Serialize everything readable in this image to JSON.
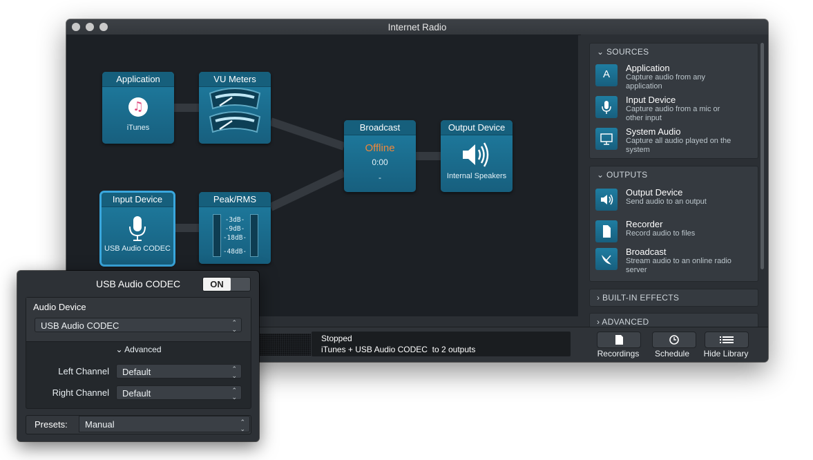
{
  "window": {
    "title": "Internet Radio"
  },
  "nodes": {
    "application": {
      "header": "Application",
      "label": "iTunes"
    },
    "vu_meters": {
      "header": "VU Meters"
    },
    "broadcast": {
      "header": "Broadcast",
      "status": "Offline",
      "time": "0:00",
      "detail": "-"
    },
    "output_device": {
      "header": "Output Device",
      "label": "Internal Speakers"
    },
    "input_device": {
      "header": "Input Device",
      "label": "USB Audio CODEC"
    },
    "peak_rms": {
      "header": "Peak/RMS",
      "scale": [
        "-3dB-",
        "-9dB-",
        "-18dB-",
        "-48dB-"
      ]
    }
  },
  "sidebar": {
    "sources": {
      "title": "SOURCES",
      "items": [
        {
          "title": "Application",
          "desc": "Capture audio from any application",
          "icon": "app-store-icon"
        },
        {
          "title": "Input Device",
          "desc": "Capture audio from a mic or other input",
          "icon": "microphone-icon"
        },
        {
          "title": "System Audio",
          "desc": "Capture all audio played on the system",
          "icon": "monitor-icon"
        }
      ]
    },
    "outputs": {
      "title": "OUTPUTS",
      "items": [
        {
          "title": "Output Device",
          "desc": "Send audio to an output",
          "icon": "speaker-icon"
        },
        {
          "title": "Recorder",
          "desc": "Record audio to files",
          "icon": "file-icon"
        },
        {
          "title": "Broadcast",
          "desc": "Stream audio to an online radio server",
          "icon": "satellite-dish-icon"
        }
      ]
    },
    "built_in_effects": {
      "title": "BUILT-IN EFFECTS"
    },
    "advanced": {
      "title": "ADVANCED"
    }
  },
  "status": {
    "line1": "Stopped",
    "line2": "iTunes + USB Audio CODEC  to 2 outputs"
  },
  "toolbar": {
    "recordings": "Recordings",
    "schedule": "Schedule",
    "hide_library": "Hide Library"
  },
  "popover": {
    "device_name": "USB Audio CODEC",
    "toggle": "ON",
    "audio_device_label": "Audio Device",
    "audio_device_value": "USB Audio CODEC",
    "advanced_label": "Advanced",
    "left_channel_label": "Left Channel",
    "left_channel_value": "Default",
    "right_channel_label": "Right Channel",
    "right_channel_value": "Default",
    "presets_label": "Presets:",
    "presets_value": "Manual"
  },
  "colors": {
    "node": "#1f7da1",
    "offline": "#f0883a",
    "selected": "#3aa7dd",
    "canvas": "#1c2025"
  }
}
